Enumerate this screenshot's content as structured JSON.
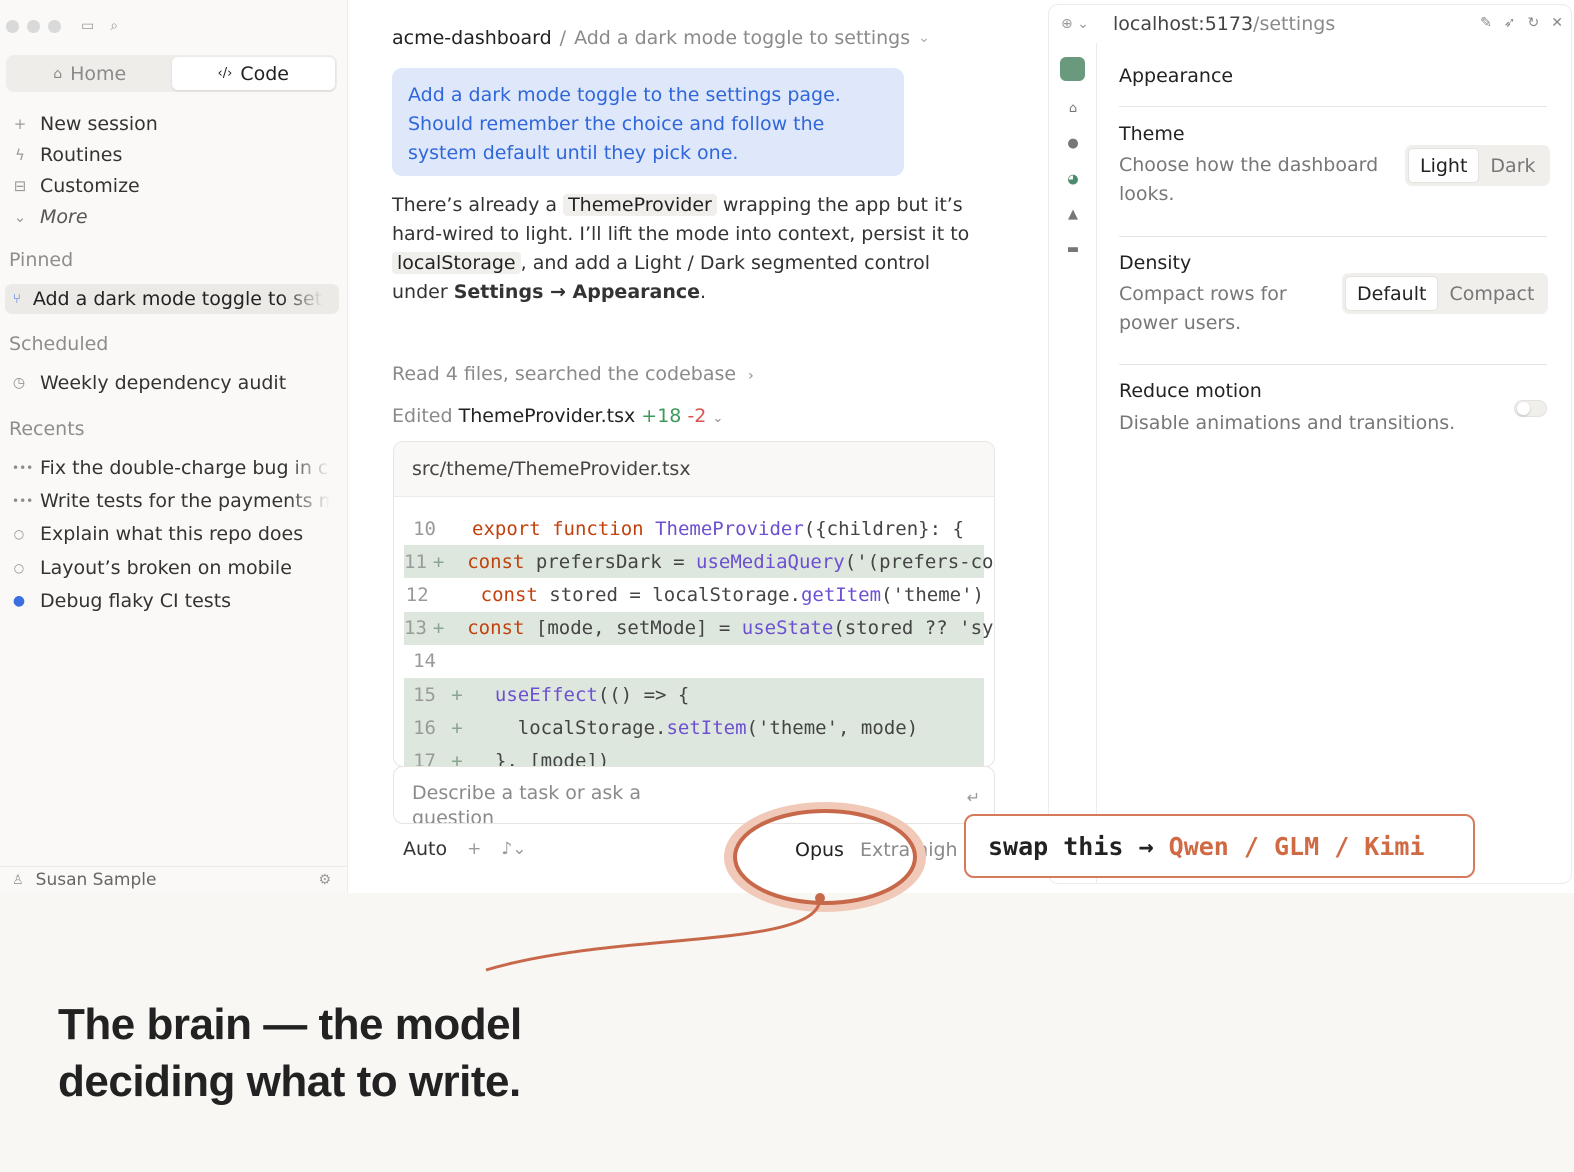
{
  "sidebar": {
    "tabs": [
      {
        "label": "Home",
        "icon": "home-icon"
      },
      {
        "label": "Code",
        "icon": "code-icon"
      }
    ],
    "nav": [
      {
        "label": "New session",
        "icon": "plus-icon"
      },
      {
        "label": "Routines",
        "icon": "bolt-icon"
      },
      {
        "label": "Customize",
        "icon": "box-icon"
      },
      {
        "label": "More",
        "icon": "chevron-down-icon"
      }
    ],
    "pinned_label": "Pinned",
    "pinned_item": "Add a dark mode toggle to settings",
    "scheduled_label": "Scheduled",
    "scheduled_item": "Weekly dependency audit",
    "recents_label": "Recents",
    "recents": [
      "Fix the double-charge bug in checkout",
      "Write tests for the payments module",
      "Explain what this repo does",
      "Layout’s broken on mobile",
      "Debug flaky CI tests"
    ],
    "user": "Susan Sample"
  },
  "main": {
    "breadcrumb": {
      "project": "acme-dashboard",
      "separator": "/",
      "task": "Add a dark mode toggle to settings"
    },
    "prompt": "Add a dark mode toggle to the settings page. Should remember the choice and follow the system default until they pick one.",
    "reply": {
      "t1": "There’s already a ",
      "c1": "ThemeProvider",
      "t2": " wrapping the app but it’s hard-wired to light. I’ll lift the mode into context, persist it to ",
      "c2": "localStorage",
      "t3": ", and add a Light / Dark segmented control under ",
      "b1": "Settings → Appearance",
      "t4": "."
    },
    "activity_read": "Read 4 files, searched the codebase",
    "activity_edit": {
      "prefix": "Edited ",
      "file": "ThemeProvider.tsx",
      "added": "+18",
      "removed": "-2"
    },
    "code_path": "src/theme/ThemeProvider.tsx",
    "code_lines": [
      {
        "n": "10",
        "add": false,
        "code": "export function ThemeProvider({children}: {"
      },
      {
        "n": "11",
        "add": true,
        "code": "  const prefersDark = useMediaQuery('(prefers-color-scheme: dark)')"
      },
      {
        "n": "12",
        "add": false,
        "code": "  const stored = localStorage.getItem('theme')"
      },
      {
        "n": "13",
        "add": true,
        "code": "  const [mode, setMode] = useState(stored ?? 'system')"
      },
      {
        "n": "14",
        "add": false,
        "code": ""
      },
      {
        "n": "15",
        "add": true,
        "code": "  useEffect(() => {"
      },
      {
        "n": "16",
        "add": true,
        "code": "    localStorage.setItem('theme', mode)"
      },
      {
        "n": "17",
        "add": true,
        "code": "  }, [mode])"
      }
    ],
    "input_placeholder": "Describe a task or ask a question",
    "mode": "Auto",
    "model": "Opus",
    "effort": "Extra high"
  },
  "browser": {
    "url_host": "localhost:5173",
    "url_path": "/settings",
    "title": "Appearance",
    "theme": {
      "name": "Theme",
      "desc": "Choose how the dashboard looks.",
      "options": [
        "Light",
        "Dark"
      ],
      "selected": "Light"
    },
    "density": {
      "name": "Density",
      "desc": "Compact rows for power users.",
      "options": [
        "Default",
        "Compact"
      ],
      "selected": "Default"
    },
    "motion": {
      "name": "Reduce motion",
      "desc": "Disable animations and transitions.",
      "enabled": false
    }
  },
  "annotation": {
    "callout_prefix": "swap this →",
    "callout_models": "Qwen / GLM / Kimi",
    "headline_1": "The brain — the model",
    "headline_2": "deciding what to write.",
    "accent": "#d06a44"
  }
}
